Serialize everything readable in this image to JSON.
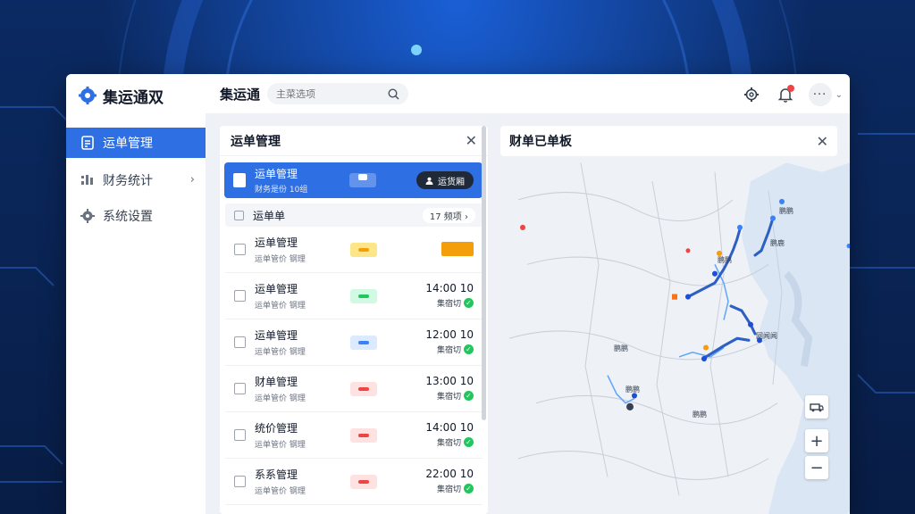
{
  "brand": {
    "name": "集运通双"
  },
  "header": {
    "title": "集运通",
    "search_placeholder": "主菜选项",
    "more": "···",
    "caret": "⌄"
  },
  "sidebar": {
    "items": [
      {
        "label": "运单管理",
        "icon": "document-icon",
        "active": true
      },
      {
        "label": "财务统计",
        "icon": "stats-icon",
        "chevron": "›"
      },
      {
        "label": "系统设置",
        "icon": "gear-icon"
      }
    ]
  },
  "left_panel": {
    "title": "运单管理",
    "close": "✕",
    "active_item": {
      "title": "运单管理",
      "subtitle": "财务是份 10组",
      "chip": "",
      "button": "运货厢"
    },
    "group": {
      "label": "运单单",
      "count": "17 频项 ›"
    },
    "rows": [
      {
        "title": "运单管理",
        "subtitle": "运单管价 钢理",
        "tag_color": "#fde68a",
        "tag_dot": "#f59e0b",
        "time": "",
        "status": "",
        "pending": true
      },
      {
        "title": "运单管理",
        "subtitle": "运单管价 钢理",
        "tag_color": "#d1fae5",
        "tag_dot": "#22c55e",
        "time": "14:00 10",
        "status": "集宿切"
      },
      {
        "title": "运单管理",
        "subtitle": "运单管价 钢理",
        "tag_color": "#dbeafe",
        "tag_dot": "#3b82f6",
        "time": "12:00 10",
        "status": "集宿切"
      },
      {
        "title": "财单管理",
        "subtitle": "运单管价 钢理",
        "tag_color": "#fee2e2",
        "tag_dot": "#ef4444",
        "time": "13:00 10",
        "status": "集宿切"
      },
      {
        "title": "统价管理",
        "subtitle": "运单管价 钢理",
        "tag_color": "#fee2e2",
        "tag_dot": "#ef4444",
        "time": "14:00 10",
        "status": "集宿切"
      },
      {
        "title": "系系管理",
        "subtitle": "运单管价 钢理",
        "tag_color": "#fee2e2",
        "tag_dot": "#ef4444",
        "time": "22:00 10",
        "status": "集宿切"
      }
    ]
  },
  "map_panel": {
    "title": "财单已单板",
    "close": "✕",
    "labels": [
      "鹏鹏",
      "鹏鹿",
      "鹏鹏",
      "鹏鹏",
      "网闻闻",
      "鹏鹏",
      "鹏鹏"
    ],
    "zoom_in": "+",
    "zoom_out": "−"
  },
  "colors": {
    "accent": "#2f6fe4",
    "route": "#2d5fc4"
  }
}
